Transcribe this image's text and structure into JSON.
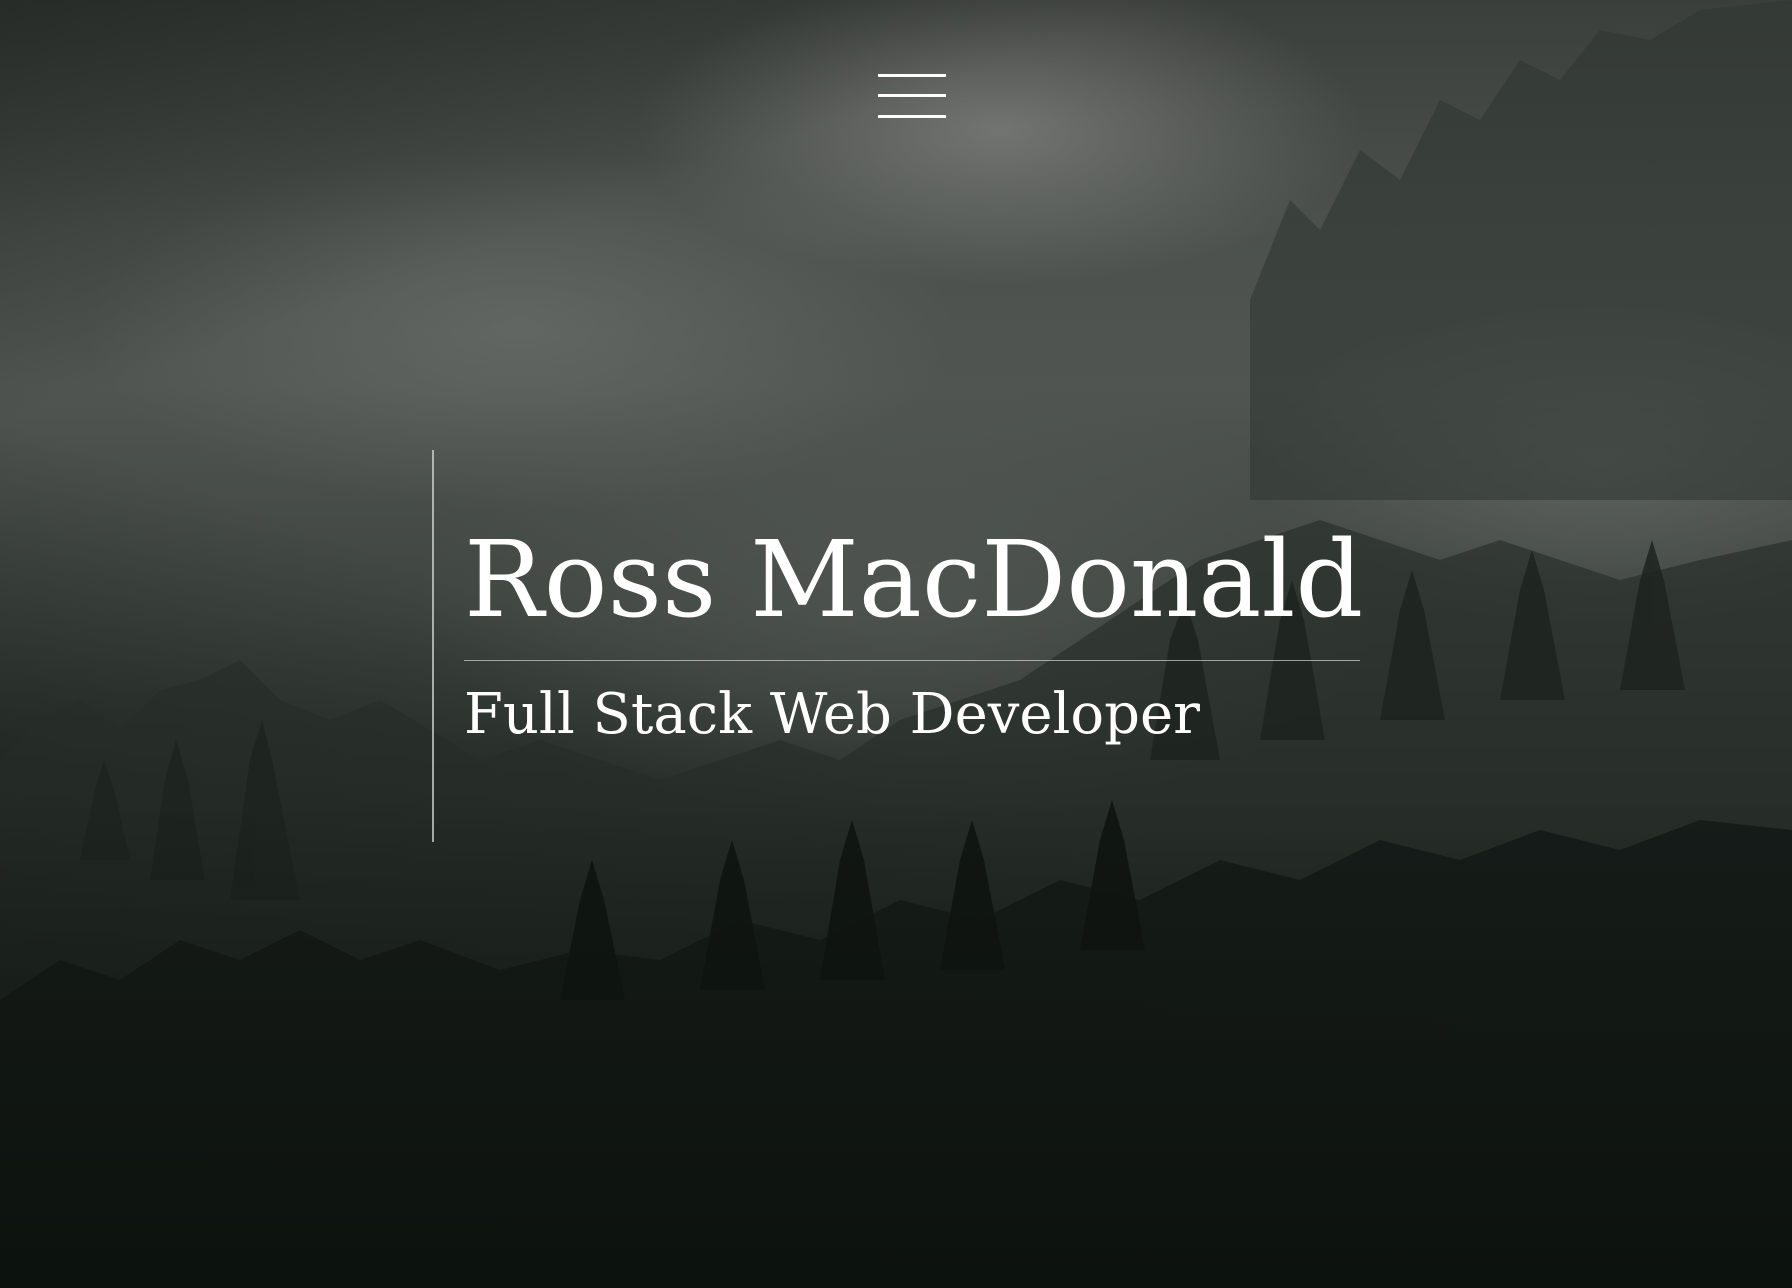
{
  "hero": {
    "background_image": "misty-forest-background",
    "menu_icon": "hamburger-menu-icon",
    "name": "Ross MacDonald",
    "title": "Full Stack Web Developer"
  },
  "colors": {
    "text": "#ffffff",
    "rule": "#d2d6d2",
    "background_dark": "#0c120e",
    "fog": "#6b706c"
  }
}
